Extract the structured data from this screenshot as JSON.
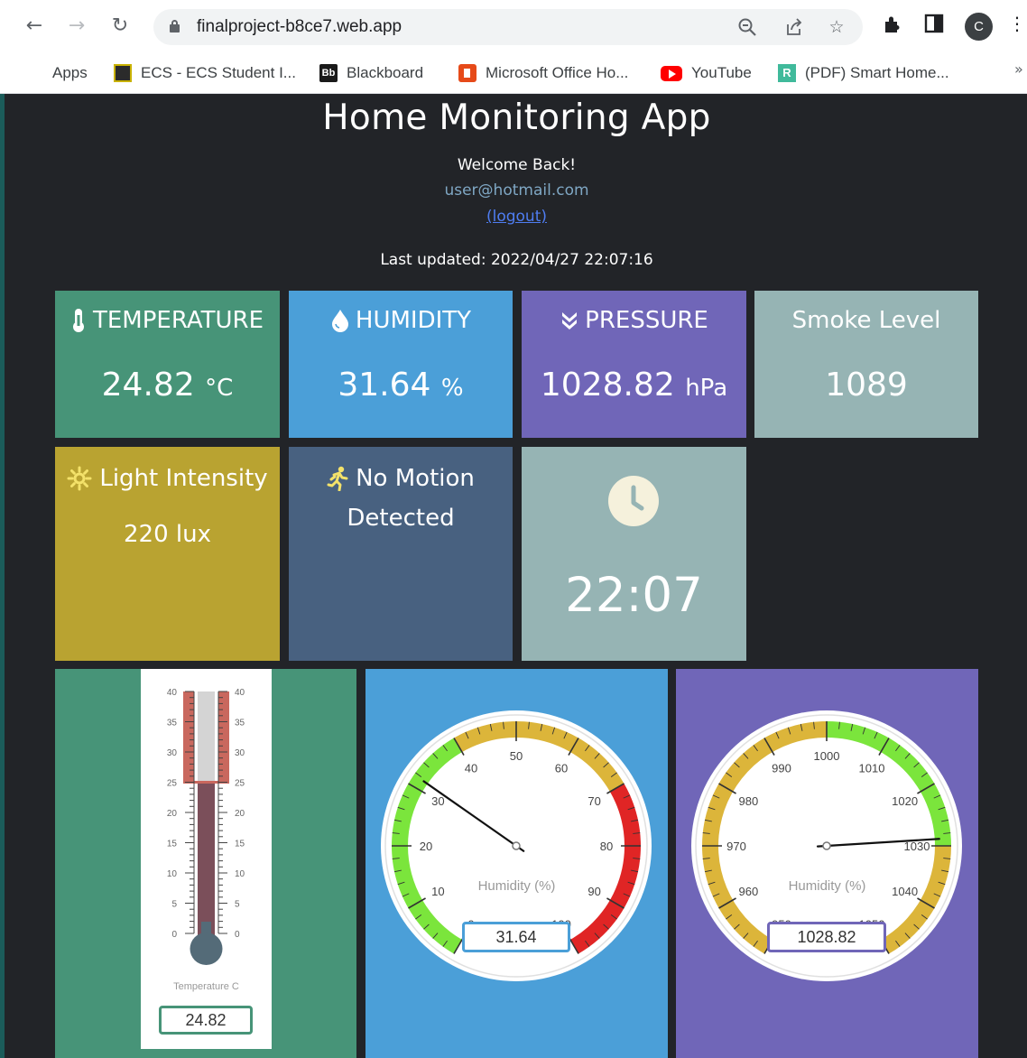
{
  "browser": {
    "url": "finalproject-b8ce7.web.app",
    "avatar_letter": "C",
    "bookmarks": [
      {
        "label": "Apps"
      },
      {
        "label": "ECS - ECS Student I..."
      },
      {
        "label": "Blackboard"
      },
      {
        "label": "Microsoft Office Ho..."
      },
      {
        "label": "YouTube"
      },
      {
        "label": "(PDF) Smart Home..."
      }
    ],
    "bookmarks_more": "»"
  },
  "header": {
    "title": "Home Monitoring App",
    "welcome": "Welcome Back!",
    "email": "user@hotmail.com",
    "logout": "(logout)",
    "last_updated": "Last updated: 2022/04/27 22:07:16"
  },
  "cards": {
    "temperature": {
      "title": "TEMPERATURE",
      "value": "24.82",
      "unit": "°C",
      "color": "#479478"
    },
    "humidity": {
      "title": "HUMIDITY",
      "value": "31.64",
      "unit": "%",
      "color": "#4b9fd8"
    },
    "pressure": {
      "title": "PRESSURE",
      "value": "1028.82",
      "unit": "hPa",
      "color": "#7066b8"
    },
    "smoke": {
      "title": "Smoke Level",
      "value": "1089",
      "color": "#96b4b4"
    },
    "light": {
      "title": "Light Intensity",
      "value": "220 lux",
      "color": "#b9a331"
    },
    "motion": {
      "line1": "No Motion",
      "line2": "Detected",
      "color": "#486180"
    },
    "clock": {
      "time": "22:07",
      "color": "#96b4b4"
    }
  },
  "gauges": {
    "thermometer": {
      "label": "Temperature C",
      "readout": "24.82",
      "value": 24.82,
      "min": 0,
      "max": 40,
      "ticks": [
        "0",
        "5",
        "10",
        "15",
        "20",
        "25",
        "30",
        "35",
        "40"
      ],
      "highlight_from": 25,
      "colors": {
        "fill": "#7b4f5a",
        "bulb": "#546b78",
        "warn": "#c9685e",
        "readout_border": "#479478"
      }
    },
    "humidity": {
      "label": "Humidity (%)",
      "readout": "31.64",
      "value": 31.64,
      "min": 0,
      "max": 100,
      "ticks": [
        "0",
        "10",
        "20",
        "30",
        "40",
        "50",
        "60",
        "70",
        "80",
        "90",
        "100"
      ],
      "zones": [
        {
          "from": 0,
          "to": 40,
          "color": "#7be53c"
        },
        {
          "from": 40,
          "to": 70,
          "color": "#dcb53a"
        },
        {
          "from": 70,
          "to": 100,
          "color": "#e02525"
        }
      ],
      "readout_border": "#4b9fd8"
    },
    "pressure": {
      "label": "Humidity (%)",
      "readout": "1028.82",
      "value": 1028.82,
      "min": 950,
      "max": 1050,
      "ticks": [
        "950",
        "960",
        "970",
        "980",
        "990",
        "1000",
        "1010",
        "1020",
        "1030",
        "1040",
        "1050"
      ],
      "zones": [
        {
          "from": 950,
          "to": 1000,
          "color": "#dcb53a"
        },
        {
          "from": 1000,
          "to": 1030,
          "color": "#7be53c"
        },
        {
          "from": 1030,
          "to": 1050,
          "color": "#dcb53a"
        }
      ],
      "readout_border": "#7066b8"
    }
  }
}
